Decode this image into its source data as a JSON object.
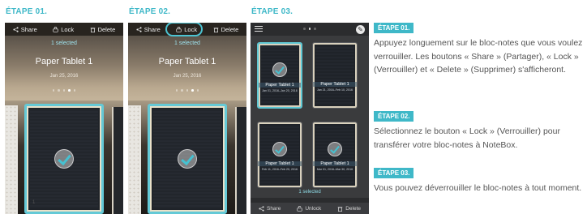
{
  "steps": [
    {
      "label": "ÉTAPE 01."
    },
    {
      "label": "ÉTAPE 02."
    },
    {
      "label": "ÉTAPE 03."
    }
  ],
  "phone1": {
    "toolbar": {
      "share": "Share",
      "lock": "Lock",
      "delete": "Delete"
    },
    "selected": "1 selected",
    "title": "Paper Tablet 1",
    "date": "Jan 25, 2016",
    "page_number": "1"
  },
  "phone2": {
    "toolbar": {
      "share": "Share",
      "lock": "Lock",
      "delete": "Delete"
    },
    "selected": "1 selected",
    "title": "Paper Tablet 1",
    "date": "Jan 25, 2016"
  },
  "phone3": {
    "tiles": [
      {
        "title": "Paper Tablet 1",
        "date": "Jan 01, 2016–Jan 20, 2016",
        "selected": true
      },
      {
        "title": "Paper Tablet 1",
        "date": "Jan 21, 2016–Feb 10, 2016",
        "selected": false
      },
      {
        "title": "Paper Tablet 1",
        "date": "Feb 11, 2016–Feb 20, 2016",
        "selected": false
      },
      {
        "title": "Paper Tablet 1",
        "date": "Mar 01, 2016–Mar 30, 2016",
        "selected": false
      }
    ],
    "selected": "1 selected",
    "bottombar": {
      "share": "Share",
      "unlock": "Unlock",
      "delete": "Delete"
    }
  },
  "instructions": [
    {
      "badge": "ÉTAPE 01.",
      "text": "Appuyez longuement sur le bloc-notes que vous voulez verrouiller. Les boutons « Share » (Partager), « Lock » (Verrouiller) et « Delete » (Supprimer) s'afficheront."
    },
    {
      "badge": "ÉTAPE 02.",
      "text": "Sélectionnez le bouton « Lock » (Verrouiller) pour transférer votre bloc-notes à NoteBox."
    },
    {
      "badge": "ÉTAPE 03.",
      "text": "Vous pouvez déverrouiller le bloc-notes à tout moment."
    }
  ],
  "colors": {
    "accent": "#3fb8c8",
    "text": "#555555"
  }
}
